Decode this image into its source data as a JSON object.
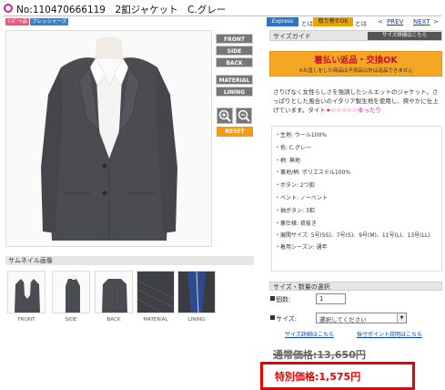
{
  "header": {
    "title": "No:110470666119　2釦ジャケット　C.グレー",
    "tag_new": "ｲﾝﾎﾟｰﾄ品",
    "tag_free": "フレッシャーズ",
    "express_badge": "Express",
    "express_text": "とは",
    "cod_badge": "取り寄せOK",
    "cod_text": "とは",
    "prev_label": "PREV",
    "next_label": "NEXT"
  },
  "view_buttons": [
    "FRONT",
    "SIDE",
    "BACK",
    "MATERIAL",
    "LINING"
  ],
  "reset_label": "RESET",
  "size_guide": {
    "title": "サイズガイド",
    "detail_button": "サイズ詳細はこちら"
  },
  "returns": {
    "title": "着払い返品・交換OK",
    "note": "※お直しをした商品は不良品以外は返品できません"
  },
  "description": {
    "text": "さりげなく女性らしさを強調したシルエットのジャケット。さっぱりとした風合いのイタリア製生地を使用し、爽やかに仕上げています。タイト",
    "rating": "★☆☆☆☆☆ゆったり"
  },
  "specs": [
    "・生地: ウール100%",
    "・色: C.グレー",
    "・柄: 無地",
    "・裏地/柄: ポリエステル100%",
    "・ボタン: 2つ釦",
    "・ベント: ノーベント",
    "・袖ボタン: 3釦",
    "・裏仕様: 背抜き",
    "・展開サイズ: 5号(SS)、7号(S)、9号(M)、11号(L)、13号(LL)",
    "・着用シーズン: 通年"
  ],
  "thumbnails": {
    "header": "サムネイル画像",
    "labels": [
      "FRONT",
      "SIDE",
      "BACK",
      "MATERIAL",
      "LINING"
    ]
  },
  "order": {
    "header": "サイズ・数量の選択",
    "qty_label": "個数:",
    "qty_value": "1",
    "size_label": "サイズ:",
    "size_selected": "選択してください",
    "link_size_detail": "サイズ詳細はこちら",
    "link_fit_point": "採寸ポイント説明はこちら"
  },
  "price": {
    "regular": "通常価格:13,650円",
    "special": "特別価格:1,575円"
  },
  "colors": {
    "accent_pink": "#d01f8c",
    "express_blue": "#2d74c4",
    "orange": "#f39a1a",
    "price_red": "#e00000"
  }
}
